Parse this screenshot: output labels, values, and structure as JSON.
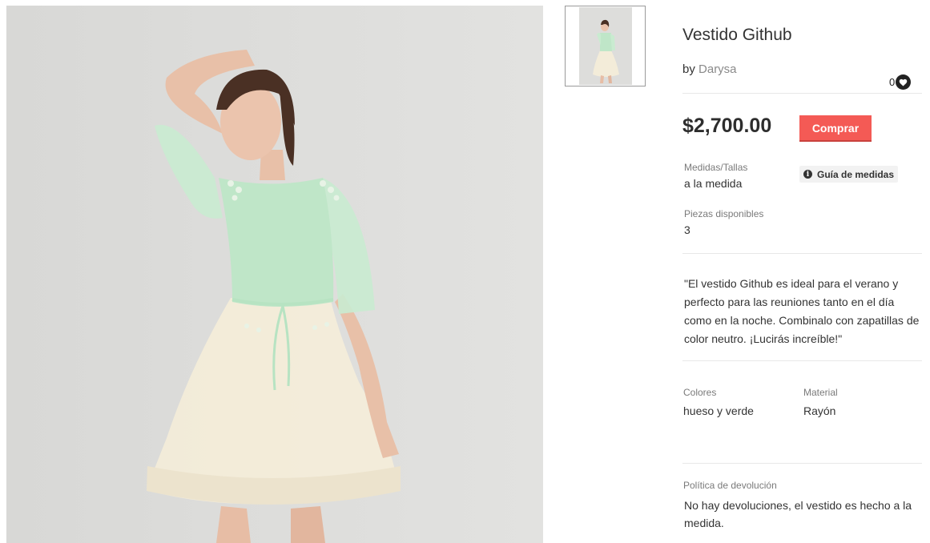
{
  "product": {
    "title": "Vestido Github",
    "by_label": "by",
    "brand": "Darysa",
    "likes": "0",
    "price": "$2,700.00",
    "buy_label": "Comprar"
  },
  "specs": {
    "size_label": "Medidas/Tallas",
    "size_value": "a la medida",
    "size_guide_label": "Guía de medidas",
    "pieces_label": "Piezas disponibles",
    "pieces_value": "3"
  },
  "description": "\"El vestido Github es ideal para el verano y perfecto para las reuniones tanto en el día como en la noche. Combinalo con zapatillas de color neutro. ¡Lucirás increíble!\"",
  "details": {
    "colors_label": "Colores",
    "colors_value": "hueso y verde",
    "material_label": "Material",
    "material_value": "Rayón"
  },
  "policy": {
    "label": "Política de devolución",
    "text": "No hay devoluciones, el vestido es hecho a la medida."
  },
  "icons": {
    "heart": "heart-icon",
    "info": "info-icon"
  },
  "colors": {
    "accent": "#f45a55",
    "dress_top": "#bfe6c8",
    "dress_skirt": "#f3ecd9"
  }
}
